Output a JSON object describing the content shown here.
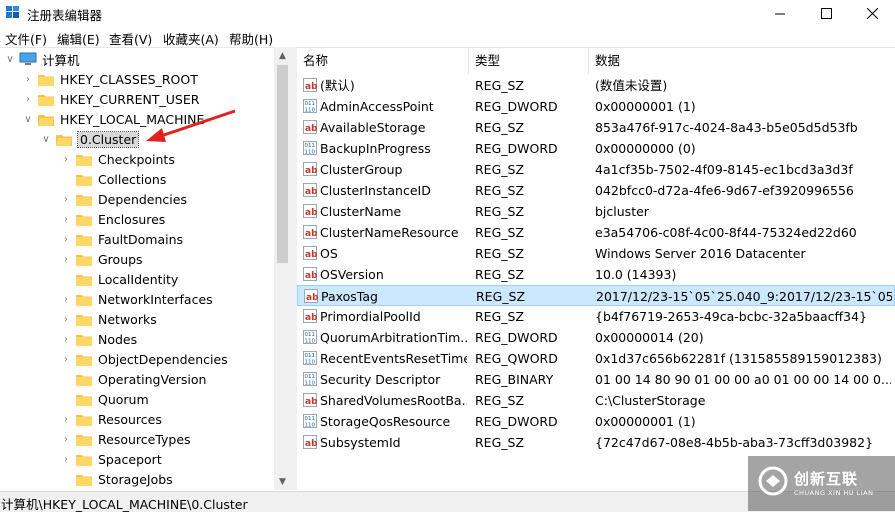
{
  "window": {
    "title": "注册表编辑器",
    "minimize_icon": "minimize-icon",
    "maximize_icon": "maximize-icon",
    "close_icon": "close-icon"
  },
  "menu": [
    "文件(F)",
    "编辑(E)",
    "查看(V)",
    "收藏夹(A)",
    "帮助(H)"
  ],
  "tree": {
    "root": "计算机",
    "hives": [
      "HKEY_CLASSES_ROOT",
      "HKEY_CURRENT_USER",
      "HKEY_LOCAL_MACHINE"
    ],
    "selected": "0.Cluster",
    "children": [
      "Checkpoints",
      "Collections",
      "Dependencies",
      "Enclosures",
      "FaultDomains",
      "Groups",
      "LocalIdentity",
      "NetworkInterfaces",
      "Networks",
      "Nodes",
      "ObjectDependencies",
      "OperatingVersion",
      "Quorum",
      "Resources",
      "ResourceTypes",
      "Spaceport",
      "StorageJobs"
    ]
  },
  "list": {
    "columns": [
      "名称",
      "类型",
      "数据"
    ],
    "rows": [
      {
        "name": "(默认)",
        "type": "REG_SZ",
        "data": "(数值未设置)",
        "icon": "string-value-icon"
      },
      {
        "name": "AdminAccessPoint",
        "type": "REG_DWORD",
        "data": "0x00000001 (1)",
        "icon": "binary-value-icon"
      },
      {
        "name": "AvailableStorage",
        "type": "REG_SZ",
        "data": "853a476f-917c-4024-8a43-b5e05d5d53fb",
        "icon": "string-value-icon"
      },
      {
        "name": "BackupInProgress",
        "type": "REG_DWORD",
        "data": "0x00000000 (0)",
        "icon": "binary-value-icon"
      },
      {
        "name": "ClusterGroup",
        "type": "REG_SZ",
        "data": "4a1cf35b-7502-4f09-8145-ec1bcd3a3d3f",
        "icon": "string-value-icon"
      },
      {
        "name": "ClusterInstanceID",
        "type": "REG_SZ",
        "data": "042bfcc0-d72a-4fe6-9d67-ef3920996556",
        "icon": "string-value-icon"
      },
      {
        "name": "ClusterName",
        "type": "REG_SZ",
        "data": "bjcluster",
        "icon": "string-value-icon"
      },
      {
        "name": "ClusterNameResource",
        "type": "REG_SZ",
        "data": "e3a54706-c08f-4c00-8f44-75324ed22d60",
        "icon": "string-value-icon"
      },
      {
        "name": "OS",
        "type": "REG_SZ",
        "data": "Windows Server 2016 Datacenter",
        "icon": "string-value-icon"
      },
      {
        "name": "OSVersion",
        "type": "REG_SZ",
        "data": "10.0 (14393)",
        "icon": "string-value-icon"
      },
      {
        "name": "PaxosTag",
        "type": "REG_SZ",
        "data": "2017/12/23-15`05`25.040_9:2017/12/23-15`05...",
        "icon": "string-value-icon"
      },
      {
        "name": "PrimordialPoolId",
        "type": "REG_SZ",
        "data": "{b4f76719-2653-49ca-bcbc-32a5baacff34}",
        "icon": "string-value-icon"
      },
      {
        "name": "QuorumArbitrationTim...",
        "type": "REG_DWORD",
        "data": "0x00000014 (20)",
        "icon": "binary-value-icon"
      },
      {
        "name": "RecentEventsResetTime",
        "type": "REG_QWORD",
        "data": "0x1d37c656b62281f (131585589159012383)",
        "icon": "binary-value-icon"
      },
      {
        "name": "Security Descriptor",
        "type": "REG_BINARY",
        "data": "01 00 14 80 90 01 00 00 a0 01 00 00 14 00 0...",
        "icon": "binary-value-icon"
      },
      {
        "name": "SharedVolumesRootBa...",
        "type": "REG_SZ",
        "data": "C:\\ClusterStorage",
        "icon": "string-value-icon"
      },
      {
        "name": "StorageQosResource",
        "type": "REG_DWORD",
        "data": "0x00000001 (1)",
        "icon": "binary-value-icon"
      },
      {
        "name": "SubsystemId",
        "type": "REG_SZ",
        "data": "{72c47d67-08e8-4b5b-aba3-73cff3d03982}",
        "icon": "string-value-icon"
      }
    ],
    "selected_row": "PaxosTag"
  },
  "status": "计算机\\HKEY_LOCAL_MACHINE\\0.Cluster",
  "watermark": {
    "main": "创新互联",
    "sub": "CHUANG XIN HU LIAN"
  },
  "colors": {
    "selection": "#cce8ff",
    "folder": "#f4c24f",
    "annotation_arrow": "#e0231e"
  }
}
